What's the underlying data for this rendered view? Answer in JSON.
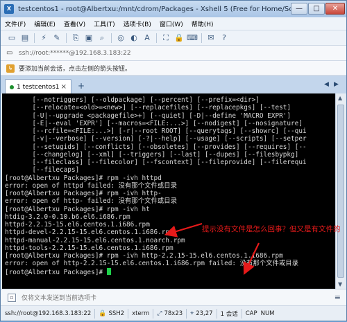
{
  "window": {
    "title": "testcentos1 - root@Albertxu:/mnt/cdrom/Packages - Xshell 5 (Free for Home/School)",
    "app_icon_letter": "X",
    "min_glyph": "—",
    "max_glyph": "□",
    "close_glyph": "✕"
  },
  "menu": [
    "文件(F)",
    "编辑(E)",
    "查看(V)",
    "工具(T)",
    "选项卡(B)",
    "窗口(W)",
    "帮助(H)"
  ],
  "address": {
    "text": "ssh://root:******@192.168.3.183:22"
  },
  "hint": {
    "text": "要添加当前会话，点击左侧的箭头按钮。"
  },
  "tab": {
    "label": "1 testcentos1",
    "close_glyph": "×",
    "add_glyph": "+",
    "nav_left": "◀",
    "nav_right": "▶"
  },
  "terminal": {
    "lines": [
      "       [--notriggers] [--oldpackage] [--percent] [--prefix=<dir>]",
      "       [--relocate=<old>=<new>] [--replacefiles] [--replacepkgs] [--test]",
      "       [-U|--upgrade <packagefile>+] [--quiet] [-D|--define 'MACRO EXPR']",
      "       [-E|--eval 'EXPR'] [--macros=<FILE:...>] [--nodigest] [--nosignature]",
      "       [--rcfile=<FILE:...>] [-r|--root ROOT] [--querytags] [--showrc] [--qui",
      "       [-v|--verbose] [--version] [-?|--help] [--usage] [--scripts] [--setper",
      "       [--setugids] [--conflicts] [--obsoletes] [--provides] [--requires] [--",
      "       [--changelog] [--xml] [--triggers] [--last] [--dupes] [--filesbypkg]",
      "       [--fileclass] [--filecolor] [--fscontext] [--fileprovide] [--filerequi",
      "       [--filecaps]",
      "[root@Albertxu Packages]# rpm -ivh httpd",
      "error: open of httpd failed: 没有那个文件或目录",
      "[root@Albertxu Packages]# rpm -ivh http-",
      "error: open of http- failed: 没有那个文件或目录",
      "[root@Albertxu Packages]# rpm -ivh ht",
      "htdig-3.2.0-0.10.b6.el6.i686.rpm",
      "httpd-2.2.15-15.el6.centos.1.i686.rpm",
      "httpd-devel-2.2.15-15.el6.centos.1.i686.rpm",
      "httpd-manual-2.2.15-15.el6.centos.1.noarch.rpm",
      "httpd-tools-2.2.15-15.el6.centos.1.i686.rpm",
      "[root@Albertxu Packages]# rpm -ivh http-2.2.15-15.el6.centos.1.i686.rpm",
      "error: open of http-2.2.15-15.el6.centos.1.i686.rpm failed: 没有那个文件或目录",
      "[root@Albertxu Packages]# "
    ]
  },
  "annotation": {
    "text": "提示没有文件是怎么回事？但又是有文件的",
    "color": "#e61a1a"
  },
  "sendbar": {
    "text": "仅将文本发送到当前选项卡",
    "menu_glyph": "≡"
  },
  "status": {
    "connection": "ssh://root@192.168.3.183:22",
    "protocol": "SSH2",
    "terminal_type": "xterm",
    "size": "78x23",
    "cursor_pos": "23,27",
    "sessions": "1 会话",
    "caps": "CAP",
    "num": "NUM"
  },
  "colors": {
    "terminal_bg": "#000000",
    "terminal_fg": "#d8d8d8",
    "cursor": "#1fd14a",
    "annotation": "#e61a1a"
  }
}
